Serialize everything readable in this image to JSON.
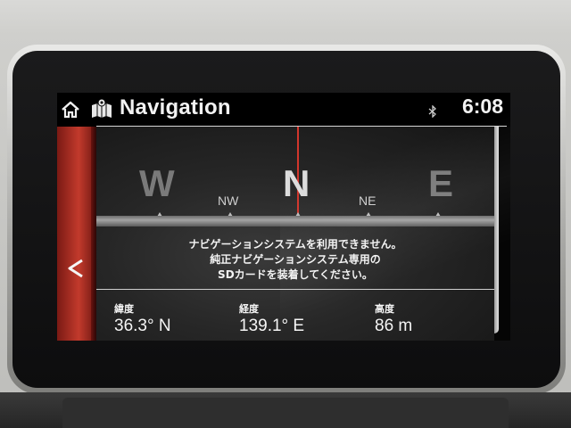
{
  "header": {
    "title": "Navigation",
    "clock": "6:08",
    "icons": [
      "home-icon",
      "map-icon",
      "bluetooth-icon"
    ]
  },
  "compass": {
    "cardinals": [
      "W",
      "N",
      "E"
    ],
    "intercardinals": [
      "NW",
      "NE"
    ],
    "needle_color": "#d2362c"
  },
  "message": {
    "line1": "ナビゲーションシステムを利用できません。",
    "line2": "純正ナビゲーションシステム専用の",
    "line3": "SDカードを装着してください。"
  },
  "info": {
    "latitude": {
      "label": "緯度",
      "value": "36.3° N"
    },
    "longitude": {
      "label": "経度",
      "value": "139.1° E"
    },
    "altitude": {
      "label": "高度",
      "value": "86 m"
    }
  },
  "colors": {
    "accent_red": "#c23a2c",
    "text": "#f2f2f2"
  }
}
